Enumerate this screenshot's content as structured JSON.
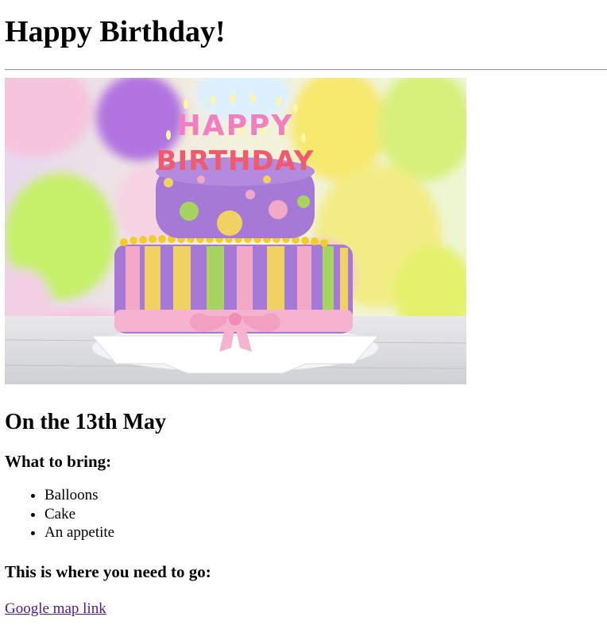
{
  "page": {
    "title": "Happy Birthday!",
    "date_heading": "On the 13th May",
    "bring_heading": "What to bring:",
    "bring_items": [
      "Balloons",
      "Cake",
      "An appetite"
    ],
    "where_heading": "This is where you need to go:",
    "map_link_label": "Google map link"
  },
  "image": {
    "cake_topper_line1": "HAPPY",
    "cake_topper_line2": "BIRTHDAY",
    "subject": "cake-photo"
  },
  "colors": {
    "visited_link": "#551a8b",
    "divider": "#9a9a9a"
  }
}
